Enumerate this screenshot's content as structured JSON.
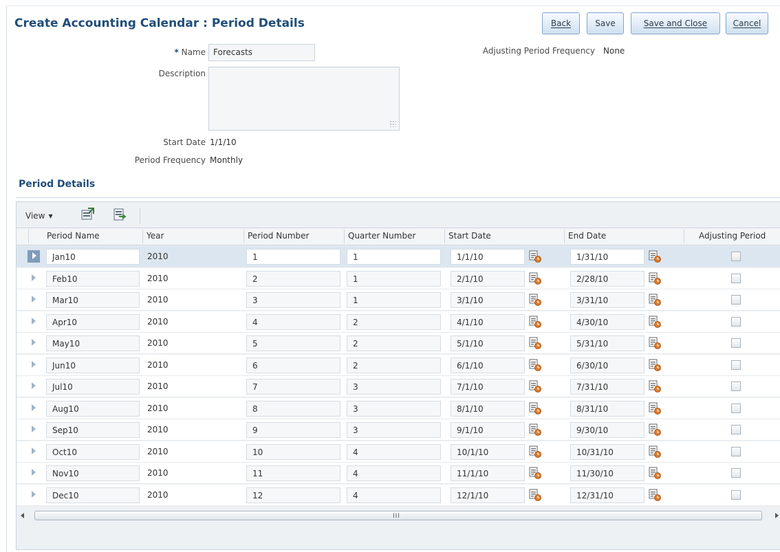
{
  "page": {
    "title": "Create Accounting Calendar : Period Details"
  },
  "buttons": {
    "back": "Back",
    "save": "Save",
    "save_and_close": "Save and Close",
    "cancel": "Cancel"
  },
  "form": {
    "required_marker": "*",
    "name_label": "Name",
    "name_value": "Forecasts",
    "description_label": "Description",
    "description_value": "",
    "start_date_label": "Start Date",
    "start_date_value": "1/1/10",
    "period_frequency_label": "Period Frequency",
    "period_frequency_value": "Monthly",
    "adjusting_label": "Adjusting Period Frequency",
    "adjusting_value": "None"
  },
  "section": {
    "title": "Period Details"
  },
  "toolbar": {
    "view_label": "View",
    "icons": [
      "export-icon",
      "detach-icon"
    ]
  },
  "table": {
    "columns": [
      "Period Name",
      "Year",
      "Period Number",
      "Quarter Number",
      "Start Date",
      "End Date",
      "Adjusting Period"
    ],
    "rows": [
      {
        "name": "Jan10",
        "year": "2010",
        "period": "1",
        "quarter": "1",
        "start": "1/1/10",
        "end": "1/31/10",
        "adjusting": false,
        "selected": true
      },
      {
        "name": "Feb10",
        "year": "2010",
        "period": "2",
        "quarter": "1",
        "start": "2/1/10",
        "end": "2/28/10",
        "adjusting": false
      },
      {
        "name": "Mar10",
        "year": "2010",
        "period": "3",
        "quarter": "1",
        "start": "3/1/10",
        "end": "3/31/10",
        "adjusting": false
      },
      {
        "name": "Apr10",
        "year": "2010",
        "period": "4",
        "quarter": "2",
        "start": "4/1/10",
        "end": "4/30/10",
        "adjusting": false
      },
      {
        "name": "May10",
        "year": "2010",
        "period": "5",
        "quarter": "2",
        "start": "5/1/10",
        "end": "5/31/10",
        "adjusting": false
      },
      {
        "name": "Jun10",
        "year": "2010",
        "period": "6",
        "quarter": "2",
        "start": "6/1/10",
        "end": "6/30/10",
        "adjusting": false
      },
      {
        "name": "Jul10",
        "year": "2010",
        "period": "7",
        "quarter": "3",
        "start": "7/1/10",
        "end": "7/31/10",
        "adjusting": false
      },
      {
        "name": "Aug10",
        "year": "2010",
        "period": "8",
        "quarter": "3",
        "start": "8/1/10",
        "end": "8/31/10",
        "adjusting": false
      },
      {
        "name": "Sep10",
        "year": "2010",
        "period": "9",
        "quarter": "3",
        "start": "9/1/10",
        "end": "9/30/10",
        "adjusting": false
      },
      {
        "name": "Oct10",
        "year": "2010",
        "period": "10",
        "quarter": "4",
        "start": "10/1/10",
        "end": "10/31/10",
        "adjusting": false
      },
      {
        "name": "Nov10",
        "year": "2010",
        "period": "11",
        "quarter": "4",
        "start": "11/1/10",
        "end": "11/30/10",
        "adjusting": false
      },
      {
        "name": "Dec10",
        "year": "2010",
        "period": "12",
        "quarter": "4",
        "start": "12/1/10",
        "end": "12/31/10",
        "adjusting": false
      }
    ]
  },
  "scrollbar": {
    "grip": "III"
  },
  "colors": {
    "title": "#1f4e79",
    "selected_row": "#dbe6f0",
    "button_border": "#7fa6cc"
  }
}
